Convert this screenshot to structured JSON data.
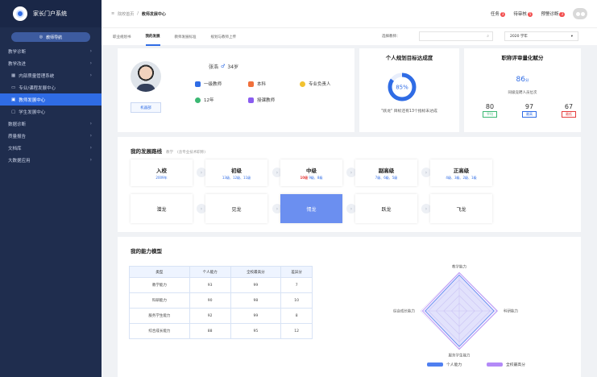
{
  "app": {
    "name": "家长门户系统"
  },
  "sidebar": {
    "work_button": "教师导航",
    "items": [
      {
        "label": "教学诊断",
        "arrow": "›"
      },
      {
        "label": "教学改进",
        "arrow": "›"
      },
      {
        "label": "内部质量管理系统",
        "arrow": "›"
      },
      {
        "label": "专业/课程发展中心",
        "arrow": ""
      },
      {
        "label": "教师发展中心",
        "arrow": "",
        "active": true
      },
      {
        "label": "学生发展中心",
        "arrow": ""
      },
      {
        "label": "数据诊断",
        "arrow": "›"
      },
      {
        "label": "质量报告",
        "arrow": "›"
      },
      {
        "label": "文档库",
        "arrow": "›"
      },
      {
        "label": "大数据应用",
        "arrow": "›"
      }
    ]
  },
  "topbar": {
    "crumb_home": "院校首页",
    "crumb_sep": "/",
    "crumb_current": "教师发展中心",
    "tasks": "任务",
    "tasks_count": "3",
    "todo": "待审核",
    "todo_count": "5",
    "alerts": "预警诊断",
    "alerts_count": "3"
  },
  "tabs": [
    "职业规划书",
    "我的发展",
    "教师发展标准",
    "规划与教师上传"
  ],
  "active_tab_index": 1,
  "filters": {
    "select_label": "选择教师：",
    "year": "2020 学年"
  },
  "profile": {
    "name": "张浩",
    "gender_symbol": "♂",
    "age": "34岁",
    "department_button": "机器部",
    "title": "一级教师",
    "degree": "本科",
    "role": "专业负责人",
    "years": "12年",
    "teaching": "授课教师"
  },
  "goal": {
    "title": "个人规划目标达成度",
    "percent": 85,
    "percent_label": "85%",
    "note": "\"跃龙\" 目标还有13个指标未达成"
  },
  "rating": {
    "title": "职称评审量化赋分",
    "score": "86",
    "score_unit": "分",
    "note": "同级竞聘人员位次",
    "stats": [
      {
        "value": "80",
        "label": "平均",
        "color": "#3bb873"
      },
      {
        "value": "97",
        "label": "最高",
        "color": "#2f6ce5"
      },
      {
        "value": "67",
        "label": "最低",
        "color": "#e53d3d"
      }
    ]
  },
  "roadmap": {
    "title": "我的发展路线",
    "subtitle_a": "教学",
    "subtitle_b": "(含专业技术职称)",
    "stages": [
      {
        "title": "入校",
        "desc": "2009年",
        "highlight": ""
      },
      {
        "title": "初级",
        "desc": "13级、12级、11级",
        "highlight": ""
      },
      {
        "title": "中级",
        "desc": "9级、8级",
        "highlight": "10级"
      },
      {
        "title": "副高级",
        "desc": "7级、6级、5级",
        "highlight": ""
      },
      {
        "title": "正高级",
        "desc": "4级、3级、2级、1级",
        "highlight": ""
      }
    ],
    "ranks": [
      "潜龙",
      "见龙",
      "惕龙",
      "跃龙",
      "飞龙"
    ],
    "active_rank_index": 2
  },
  "ability": {
    "title": "我的能力模型",
    "headers": [
      "类型",
      "个人能力",
      "全校最高分",
      "差异分"
    ],
    "rows": [
      [
        "教学能力",
        "93",
        "99",
        "7"
      ],
      [
        "科研能力",
        "90",
        "98",
        "10"
      ],
      [
        "服务学生能力",
        "92",
        "99",
        "8"
      ],
      [
        "综合成长能力",
        "88",
        "95",
        "12"
      ]
    ],
    "radar_axes": [
      "教学能力",
      "科研能力",
      "服务学生能力",
      "综合成长能力"
    ],
    "legend": [
      {
        "label": "个人能力",
        "color": "#4f7ff0"
      },
      {
        "label": "全校最高分",
        "color": "#b38af7"
      }
    ]
  }
}
